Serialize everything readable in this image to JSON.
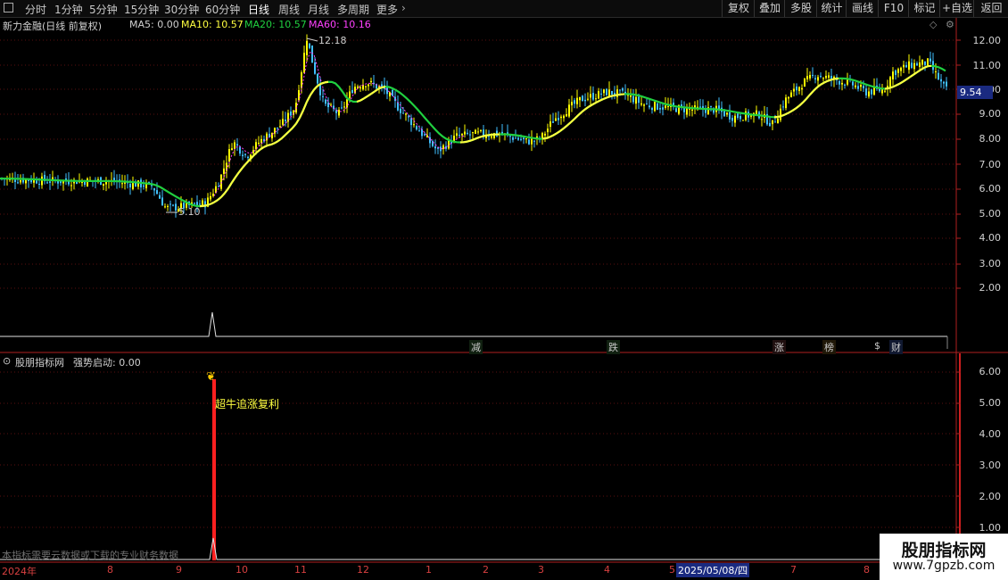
{
  "toolbar": {
    "periods": [
      "分时",
      "1分钟",
      "5分钟",
      "15分钟",
      "30分钟",
      "60分钟",
      "日线",
      "周线",
      "月线",
      "多周期",
      "更多"
    ],
    "active_period": "日线",
    "buttons": [
      "复权",
      "叠加",
      "多股",
      "统计",
      "画线",
      "F10",
      "标记",
      "+自选",
      "返回"
    ]
  },
  "main": {
    "stock_name": "新力金融(日线 前复权)",
    "ma5": "MA5: 0.00",
    "ma10": "MA10: 10.57",
    "ma20": "MA20: 10.57",
    "ma60": "MA60: 10.16",
    "high_label": "12.18",
    "low_label": "5.10",
    "current_price": "9.54",
    "price_axis": [
      "12.00",
      "11.00",
      "10.00",
      "9.00",
      "8.00",
      "7.00",
      "6.00",
      "5.00",
      "4.00",
      "3.00",
      "2.00"
    ],
    "events": [
      {
        "text": "减",
        "color": "#30c030"
      },
      {
        "text": "跌",
        "color": "#30c030"
      },
      {
        "text": "涨",
        "color": "#e04040"
      },
      {
        "text": "榜",
        "color": "#d08020"
      },
      {
        "text": "$",
        "color": "#e03030"
      },
      {
        "text": "财",
        "color": "#4080ff"
      }
    ]
  },
  "sub": {
    "indicator_name": "股朋指标网",
    "value_label": "强势启动: 0.00",
    "signal_text": "超牛追涨复利",
    "axis": [
      "6.00",
      "5.00",
      "4.00",
      "3.00",
      "2.00",
      "1.00"
    ],
    "note": "本指标需要云数据或下载的专业财务数据"
  },
  "date_axis": [
    "2024年",
    "8",
    "9",
    "10",
    "11",
    "12",
    "1",
    "2",
    "3",
    "4",
    "5",
    "7",
    "8"
  ],
  "date_highlight": "2025/05/08/四",
  "watermark": {
    "title": "股朋指标网",
    "url": "www.7gpzb.com"
  },
  "colors": {
    "up": "#ffff00",
    "down": "#40c0ff",
    "ma_yellow": "#ffff40",
    "ma_green": "#20d040",
    "ma_pink": "#ff40ff",
    "signal": "#ff2020"
  }
}
